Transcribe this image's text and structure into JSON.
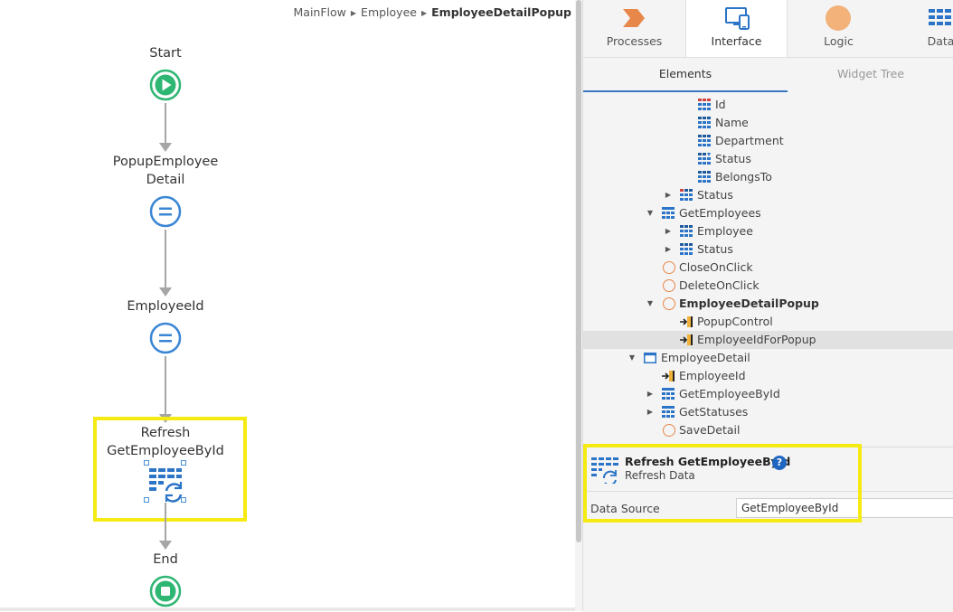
{
  "breadcrumb": {
    "items": [
      "MainFlow",
      "Employee"
    ],
    "current": "EmployeeDetailPopup"
  },
  "flow": {
    "start_label": "Start",
    "popup_label_line1": "PopupEmployee",
    "popup_label_line2": "Detail",
    "employeeid_label": "EmployeeId",
    "refresh_label_line1": "Refresh",
    "refresh_label_line2": "GetEmployeeById",
    "end_label": "End"
  },
  "top_tabs": [
    {
      "label": "Processes",
      "icon": "processes-icon"
    },
    {
      "label": "Interface",
      "icon": "interface-icon",
      "active": true
    },
    {
      "label": "Logic",
      "icon": "logic-icon"
    },
    {
      "label": "Data",
      "icon": "data-icon"
    }
  ],
  "sub_tabs": {
    "elements": "Elements",
    "widget_tree": "Widget Tree"
  },
  "tree": [
    {
      "label": "Id",
      "icon": "entity-attribute-id-icon"
    },
    {
      "label": "Name",
      "icon": "entity-attribute-icon"
    },
    {
      "label": "Department",
      "icon": "entity-attribute-icon"
    },
    {
      "label": "Status",
      "icon": "entity-attribute-ref-icon"
    },
    {
      "label": "BelongsTo",
      "icon": "entity-attribute-icon"
    },
    {
      "label": "Status",
      "icon": "entity-icon"
    },
    {
      "label": "GetEmployees",
      "icon": "aggregate-icon"
    },
    {
      "label": "Employee",
      "icon": "entity-icon"
    },
    {
      "label": "Status",
      "icon": "entity-icon"
    },
    {
      "label": "CloseOnClick",
      "icon": "action-circle-icon"
    },
    {
      "label": "DeleteOnClick",
      "icon": "action-circle-icon"
    },
    {
      "label": "EmployeeDetailPopup",
      "icon": "action-circle-icon"
    },
    {
      "label": "PopupControl",
      "icon": "input-parameter-icon"
    },
    {
      "label": "EmployeeIdForPopup",
      "icon": "input-parameter-icon"
    },
    {
      "label": "EmployeeDetail",
      "icon": "screen-icon"
    },
    {
      "label": "EmployeeId",
      "icon": "input-parameter-icon"
    },
    {
      "label": "GetEmployeeById",
      "icon": "aggregate-icon"
    },
    {
      "label": "GetStatuses",
      "icon": "aggregate-icon"
    },
    {
      "label": "SaveDetail",
      "icon": "action-circle-icon"
    }
  ],
  "properties": {
    "title": "Refresh GetEmployeeById",
    "subtitle": "Refresh Data",
    "help": "?",
    "data_source_label": "Data Source",
    "data_source_value": "GetEmployeeById"
  },
  "colors": {
    "start_green": "#2eb673",
    "node_blue": "#3a86d4",
    "highlight_yellow": "#f5ea12",
    "selection_gray": "#e1e1e1",
    "action_orange": "#e8874a",
    "help_blue": "#1f66c1"
  }
}
